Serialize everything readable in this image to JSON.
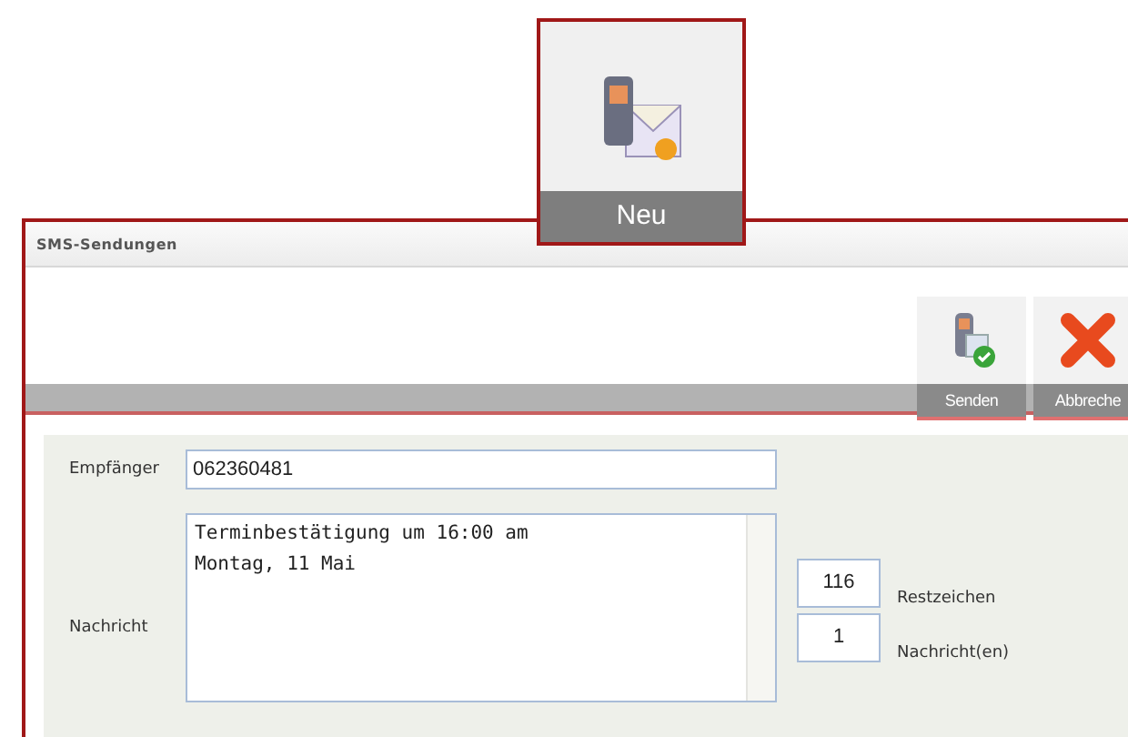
{
  "new_button": {
    "label": "Neu"
  },
  "window": {
    "title": "SMS-Sendungen"
  },
  "toolbar": [
    {
      "kind": "send",
      "label": "Senden"
    },
    {
      "kind": "cancel",
      "label": "Abbreche"
    }
  ],
  "form": {
    "recipient": {
      "label": "Empfänger",
      "value": "062360481"
    },
    "message": {
      "label": "Nachricht",
      "lines": [
        "Terminbestätigung um 16:00 am",
        "Montag, 11 Mai"
      ]
    },
    "counters": [
      {
        "value": "116",
        "label": "Restzeichen"
      },
      {
        "value": "1",
        "label": "Nachricht(en)"
      }
    ]
  }
}
